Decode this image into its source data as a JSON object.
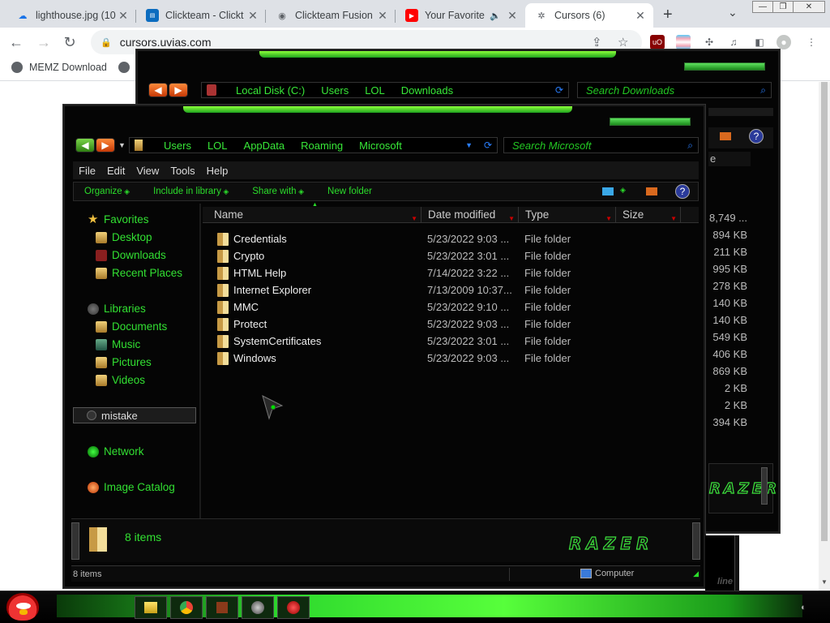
{
  "browser": {
    "tabs": [
      {
        "title": "lighthouse.jpg (10",
        "icon": "image-upload-icon",
        "color": "#1a73e8"
      },
      {
        "title": "Clickteam - Clickt",
        "icon": "clickteam-icon",
        "color": "#0c6cbf"
      },
      {
        "title": "Clickteam Fusion",
        "icon": "globe-icon",
        "color": "#5f6368"
      },
      {
        "title": "Your Favorite",
        "icon": "youtube-icon",
        "color": "#ff0000"
      },
      {
        "title": "Cursors (6)",
        "icon": "cursors-icon",
        "color": "#5f6368"
      }
    ],
    "address": "cursors.uvias.com",
    "bookmarks": [
      {
        "label": "MEMZ Download"
      }
    ]
  },
  "back_window": {
    "breadcrumbs": [
      "Local Disk (C:)",
      "Users",
      "LOL",
      "Downloads"
    ],
    "search_placeholder": "Search Downloads",
    "sizes": [
      "8,749 ...",
      "894 KB",
      "211 KB",
      "995 KB",
      "278 KB",
      "140 KB",
      "140 KB",
      "549 KB",
      "406 KB",
      "869 KB",
      "2 KB",
      "2 KB",
      "394 KB"
    ],
    "col_partial": "e",
    "status_partial": "line"
  },
  "explorer": {
    "breadcrumbs": [
      "Users",
      "LOL",
      "AppData",
      "Roaming",
      "Microsoft"
    ],
    "search_placeholder": "Search Microsoft",
    "menu": [
      "File",
      "Edit",
      "View",
      "Tools",
      "Help"
    ],
    "commands": [
      "Organize",
      "Include in library",
      "Share with",
      "New folder"
    ],
    "nav": {
      "favorites": "Favorites",
      "favorite_items": [
        "Desktop",
        "Downloads",
        "Recent Places"
      ],
      "libraries": "Libraries",
      "library_items": [
        "Documents",
        "Music",
        "Pictures",
        "Videos"
      ],
      "homegroup": "mistake",
      "network": "Network",
      "catalog": "Image Catalog"
    },
    "columns": [
      "Name",
      "Date modified",
      "Type",
      "Size"
    ],
    "rows": [
      {
        "name": "Credentials",
        "date": "5/23/2022 9:03 ...",
        "type": "File folder"
      },
      {
        "name": "Crypto",
        "date": "5/23/2022 3:01 ...",
        "type": "File folder"
      },
      {
        "name": "HTML Help",
        "date": "7/14/2022 3:22 ...",
        "type": "File folder"
      },
      {
        "name": "Internet Explorer",
        "date": "7/13/2009 10:37...",
        "type": "File folder"
      },
      {
        "name": "MMC",
        "date": "5/23/2022 9:10 ...",
        "type": "File folder"
      },
      {
        "name": "Protect",
        "date": "5/23/2022 9:03 ...",
        "type": "File folder"
      },
      {
        "name": "SystemCertificates",
        "date": "5/23/2022 3:01 ...",
        "type": "File folder"
      },
      {
        "name": "Windows",
        "date": "5/23/2022 9:03 ...",
        "type": "File folder"
      }
    ],
    "details_count": "8 items",
    "status_count": "8 items",
    "status_location": "Computer",
    "logo": "RAZER"
  },
  "colors": {
    "accent": "#32e032",
    "glow": "#57ff3b",
    "background": "#050505"
  }
}
